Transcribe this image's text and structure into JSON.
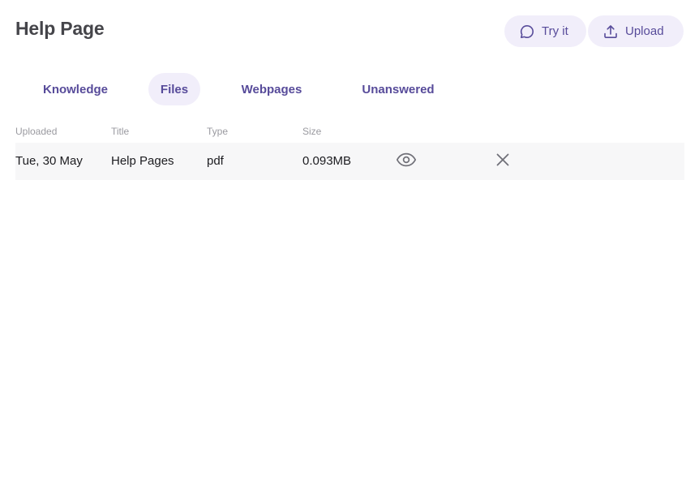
{
  "page": {
    "title": "Help Page"
  },
  "actions": {
    "try_label": "Try it",
    "upload_label": "Upload",
    "try_icon": "chat-bubble-icon",
    "upload_icon": "upload-icon"
  },
  "tabs": [
    {
      "label": "Knowledge",
      "active": false
    },
    {
      "label": "Files",
      "active": true
    },
    {
      "label": "Webpages",
      "active": false
    },
    {
      "label": "Unanswered",
      "active": false
    }
  ],
  "table": {
    "columns": [
      "Uploaded",
      "Title",
      "Type",
      "Size"
    ],
    "rows": [
      {
        "uploaded": "Tue, 30 May",
        "title": "Help Pages",
        "type": "pdf",
        "size": "0.093MB",
        "actions": [
          "eye-icon",
          "close-icon"
        ]
      }
    ]
  },
  "colors": {
    "accent": "#574b9a",
    "pill_bg": "#f1eefa",
    "row_bg": "#f7f7f8",
    "title": "#45454a",
    "header_text": "#9a9aa0"
  }
}
